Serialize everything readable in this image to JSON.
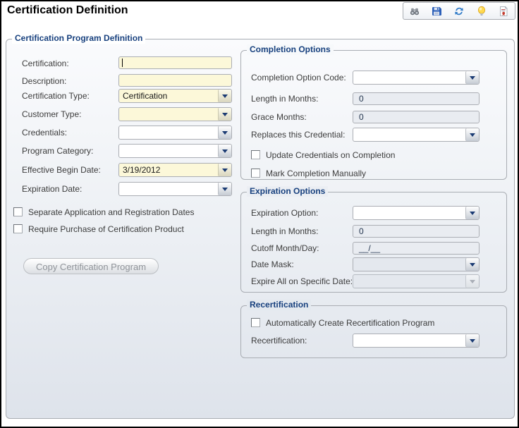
{
  "header": {
    "title": "Certification Definition",
    "toolbar_icons": [
      "binoculars-find",
      "save-disk",
      "refresh",
      "lightbulb-tip",
      "report-document"
    ]
  },
  "form": {
    "group_title": "Certification Program Definition",
    "left": {
      "certification": {
        "label": "Certification:",
        "value": ""
      },
      "description": {
        "label": "Description:",
        "value": ""
      },
      "certification_type": {
        "label": "Certification Type:",
        "value": "Certification"
      },
      "customer_type": {
        "label": "Customer Type:",
        "value": ""
      },
      "credentials": {
        "label": "Credentials:",
        "value": ""
      },
      "program_category": {
        "label": "Program Category:",
        "value": ""
      },
      "effective_begin_date": {
        "label": "Effective Begin Date:",
        "value": "3/19/2012"
      },
      "expiration_date": {
        "label": "Expiration Date:",
        "value": ""
      },
      "separate_dates_checkbox": "Separate Application and Registration Dates",
      "require_purchase_checkbox": "Require Purchase of Certification Product",
      "copy_button": "Copy Certification Program"
    },
    "completion": {
      "group_title": "Completion Options",
      "completion_option_code": {
        "label": "Completion Option Code:",
        "value": ""
      },
      "length_in_months": {
        "label": "Length in Months:",
        "value": "0"
      },
      "grace_months": {
        "label": "Grace Months:",
        "value": "0"
      },
      "replaces_credential": {
        "label": "Replaces this Credential:",
        "value": ""
      },
      "update_credentials_checkbox": "Update Credentials on Completion",
      "mark_completion_checkbox": "Mark Completion Manually"
    },
    "expiration": {
      "group_title": "Expiration Options",
      "expiration_option": {
        "label": "Expiration Option:",
        "value": ""
      },
      "length_in_months": {
        "label": "Length in Months:",
        "value": "0"
      },
      "cutoff_month_day": {
        "label": "Cutoff Month/Day:",
        "value": "__/__"
      },
      "date_mask": {
        "label": "Date Mask:",
        "value": ""
      },
      "expire_all_on_date": {
        "label": "Expire All on Specific Date:",
        "value": ""
      }
    },
    "recertification": {
      "group_title": "Recertification",
      "auto_create_checkbox": "Automatically Create Recertification Program",
      "recertification": {
        "label": "Recertification:",
        "value": ""
      }
    }
  },
  "colors": {
    "group_label_navy": "#17407E",
    "required_field_yellow": "#FCF8D9",
    "disabled_field_gray": "#E9ECF1",
    "dropdown_arrow_navy": "#1B3B73"
  }
}
